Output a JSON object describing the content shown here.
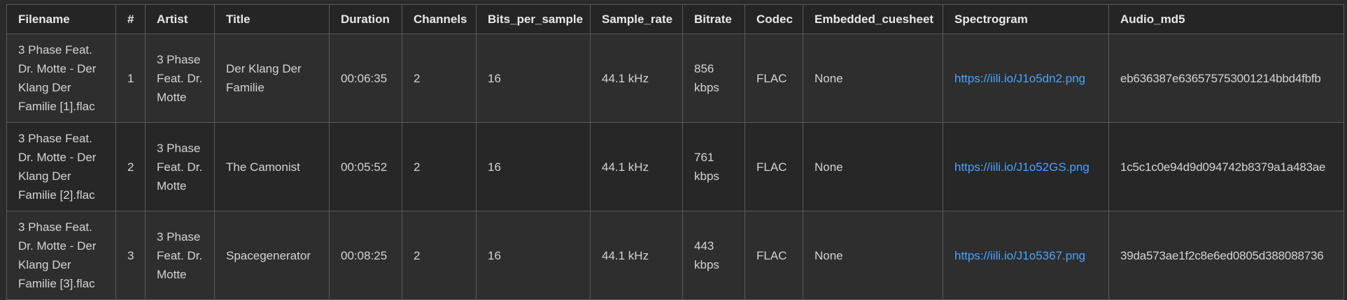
{
  "headers": [
    "Filename",
    "#",
    "Artist",
    "Title",
    "Duration",
    "Channels",
    "Bits_per_sample",
    "Sample_rate",
    "Bitrate",
    "Codec",
    "Embedded_cuesheet",
    "Spectrogram",
    "Audio_md5"
  ],
  "rows": [
    {
      "filename": "3 Phase Feat. Dr. Motte - Der Klang Der Familie [1].flac",
      "num": "1",
      "artist": "3 Phase Feat. Dr. Motte",
      "title": "Der Klang Der Familie",
      "duration": "00:06:35",
      "channels": "2",
      "bits": "16",
      "sample_rate": "44.1 kHz",
      "bitrate": "856 kbps",
      "codec": "FLAC",
      "cuesheet": "None",
      "spectrogram": "https://iili.io/J1o5dn2.png",
      "md5": "eb636387e636575753001214bbd4fbfb"
    },
    {
      "filename": "3 Phase Feat. Dr. Motte - Der Klang Der Familie [2].flac",
      "num": "2",
      "artist": "3 Phase Feat. Dr. Motte",
      "title": "The Camonist",
      "duration": "00:05:52",
      "channels": "2",
      "bits": "16",
      "sample_rate": "44.1 kHz",
      "bitrate": "761 kbps",
      "codec": "FLAC",
      "cuesheet": "None",
      "spectrogram": "https://iili.io/J1o52GS.png",
      "md5": "1c5c1c0e94d9d094742b8379a1a483ae"
    },
    {
      "filename": "3 Phase Feat. Dr. Motte - Der Klang Der Familie [3].flac",
      "num": "3",
      "artist": "3 Phase Feat. Dr. Motte",
      "title": "Spacegenerator",
      "duration": "00:08:25",
      "channels": "2",
      "bits": "16",
      "sample_rate": "44.1 kHz",
      "bitrate": "443 kbps",
      "codec": "FLAC",
      "cuesheet": "None",
      "spectrogram": "https://iili.io/J1o5367.png",
      "md5": "39da573ae1f2c8e6ed0805d388088736"
    }
  ],
  "colors": {
    "background": "#2b2b2b",
    "header_bg": "#252525",
    "border": "#5a5a5a",
    "text": "#d4d4d4",
    "link": "#4aa3ff"
  }
}
